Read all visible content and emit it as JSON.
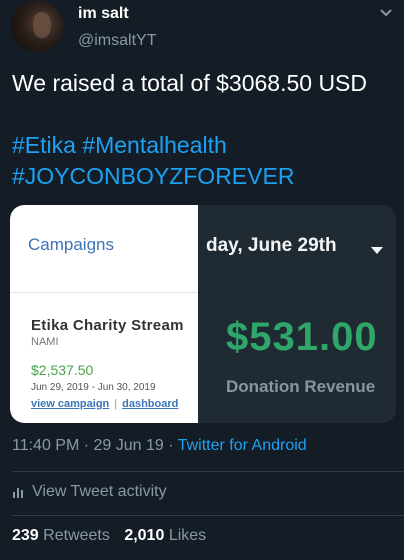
{
  "tweet": {
    "author_name": "im salt",
    "author_handle": "@imsaltYT",
    "text_line_1": "We raised a total of $3068.50 USD",
    "hashtags_line_1": "#Etika #Mentalhealth",
    "hashtags_line_2": "#JOYCONBOYZFOREVER",
    "timestamp": "11:40 PM · 29 Jun 19 · ",
    "client": "Twitter for Android",
    "view_activity": "View Tweet activity",
    "retweets_count": "239",
    "retweets_label": "Retweets",
    "likes_count": "2,010",
    "likes_label": "Likes"
  },
  "media": {
    "card_title": "Campaigns",
    "campaign_name": "Etika Charity Stream",
    "campaign_org": "NAMI",
    "campaign_amount": "$2,537.50",
    "campaign_dates": "Jun 29, 2019 - Jun 30, 2019",
    "view_campaign": "view campaign",
    "separator": "|",
    "dashboard": "dashboard",
    "date_label": "day, June 29th",
    "revenue": "$531.00",
    "revenue_label": "Donation Revenue"
  },
  "colors": {
    "background": "#141d26",
    "link_blue": "#1da1f2",
    "muted": "#8899a6",
    "revenue_green": "#2fa66a"
  },
  "icons": [
    "avatar",
    "chevron-down-icon",
    "caret-down-icon",
    "bar-chart-icon"
  ]
}
